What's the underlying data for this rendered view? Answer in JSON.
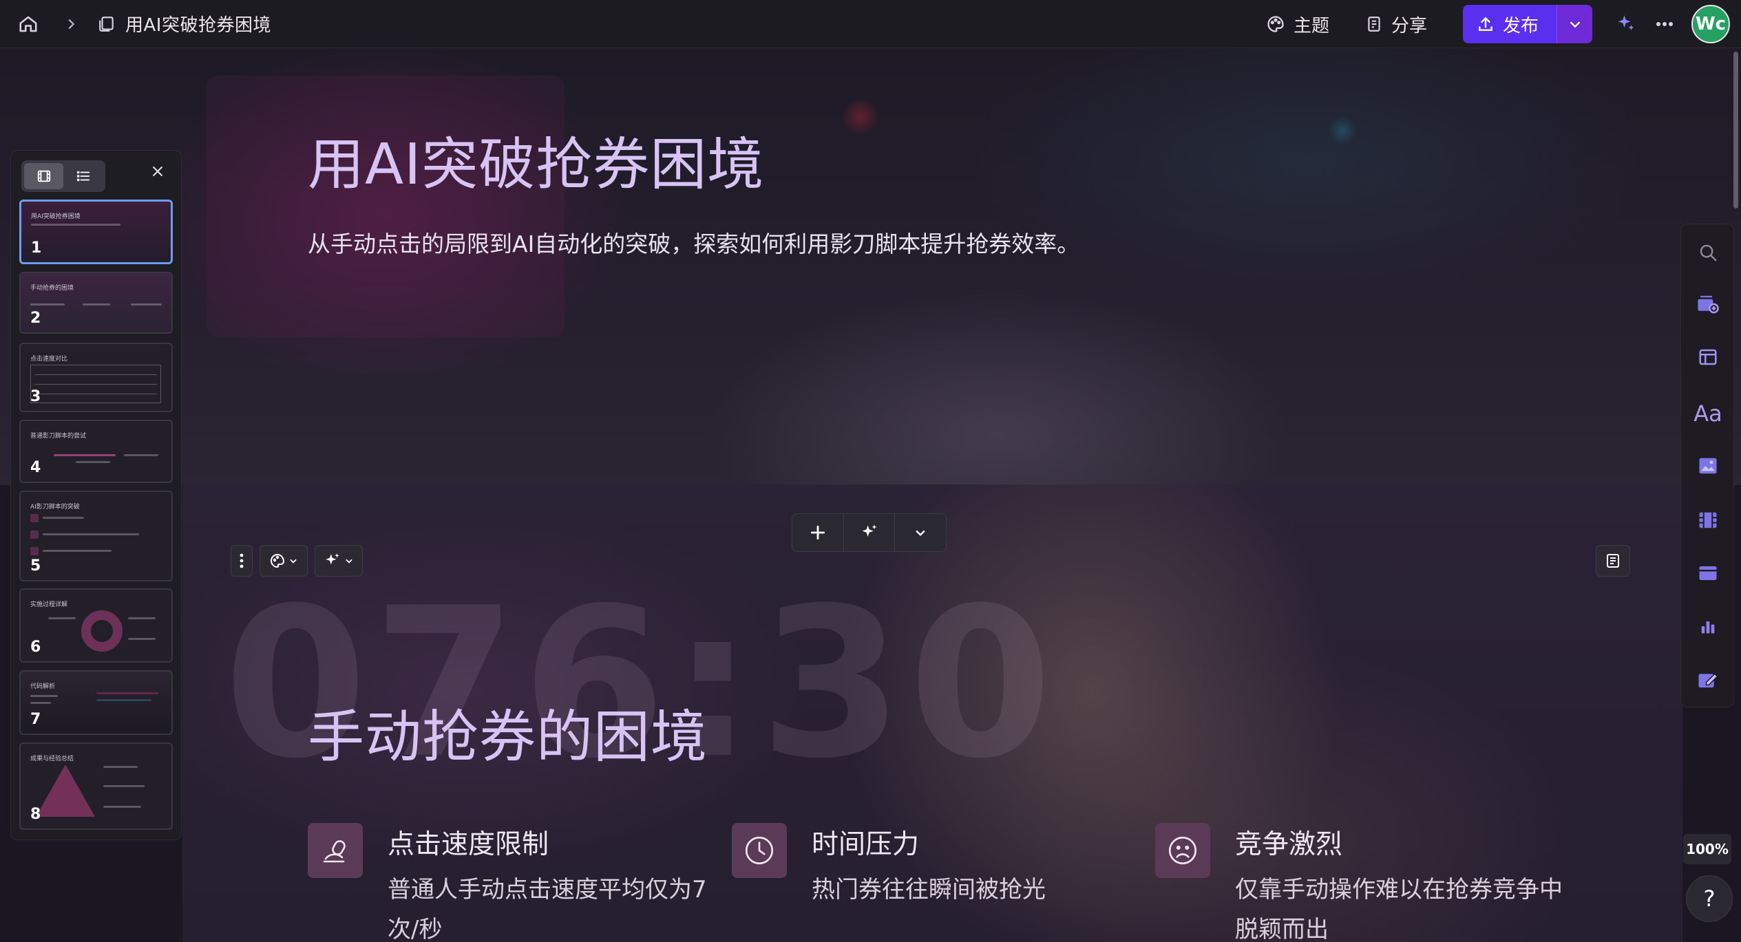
{
  "topbar": {
    "breadcrumb_title": "用AI突破抢券困境",
    "theme_label": "主题",
    "share_label": "分享",
    "publish_label": "发布",
    "avatar_text": "Wc"
  },
  "hero": {
    "title": "用AI突破抢券困境",
    "subtitle": "从手动点击的局限到AI自动化的突破，探索如何利用影刀脚本提升抢券效率。"
  },
  "slide2": {
    "background_text": "076:30",
    "title": "手动抢券的困境",
    "features": [
      {
        "icon": "mouse-icon",
        "heading": "点击速度限制",
        "body": "普通人手动点击速度平均仅为7次/秒"
      },
      {
        "icon": "clock-icon",
        "heading": "时间压力",
        "body": "热门券往往瞬间被抢光"
      },
      {
        "icon": "sad-face-icon",
        "heading": "竞争激烈",
        "body": "仅靠手动操作难以在抢券竞争中脱颖而出"
      }
    ]
  },
  "thumbnails": [
    {
      "number": "1",
      "title": "用AI突破抢券困境"
    },
    {
      "number": "2",
      "title": "手动抢券的困境"
    },
    {
      "number": "3",
      "title": "点击速度对比"
    },
    {
      "number": "4",
      "title": "普通影刀脚本的尝试"
    },
    {
      "number": "5",
      "title": "AI影刀脚本的突破"
    },
    {
      "number": "6",
      "title": "实施过程详解"
    },
    {
      "number": "7",
      "title": "代码解析"
    },
    {
      "number": "8",
      "title": "成果与经验总结"
    }
  ],
  "right_rail": {
    "text_tool_label": "Aa"
  },
  "zoom": "100%",
  "help": "?",
  "colors": {
    "accent_publish": "#5a2ff0",
    "title_lavender": "#d7c3f4",
    "icon_tile": "#5a3a56",
    "avatar_green": "#27a163",
    "thumb_active_border": "#6f9cf2"
  }
}
